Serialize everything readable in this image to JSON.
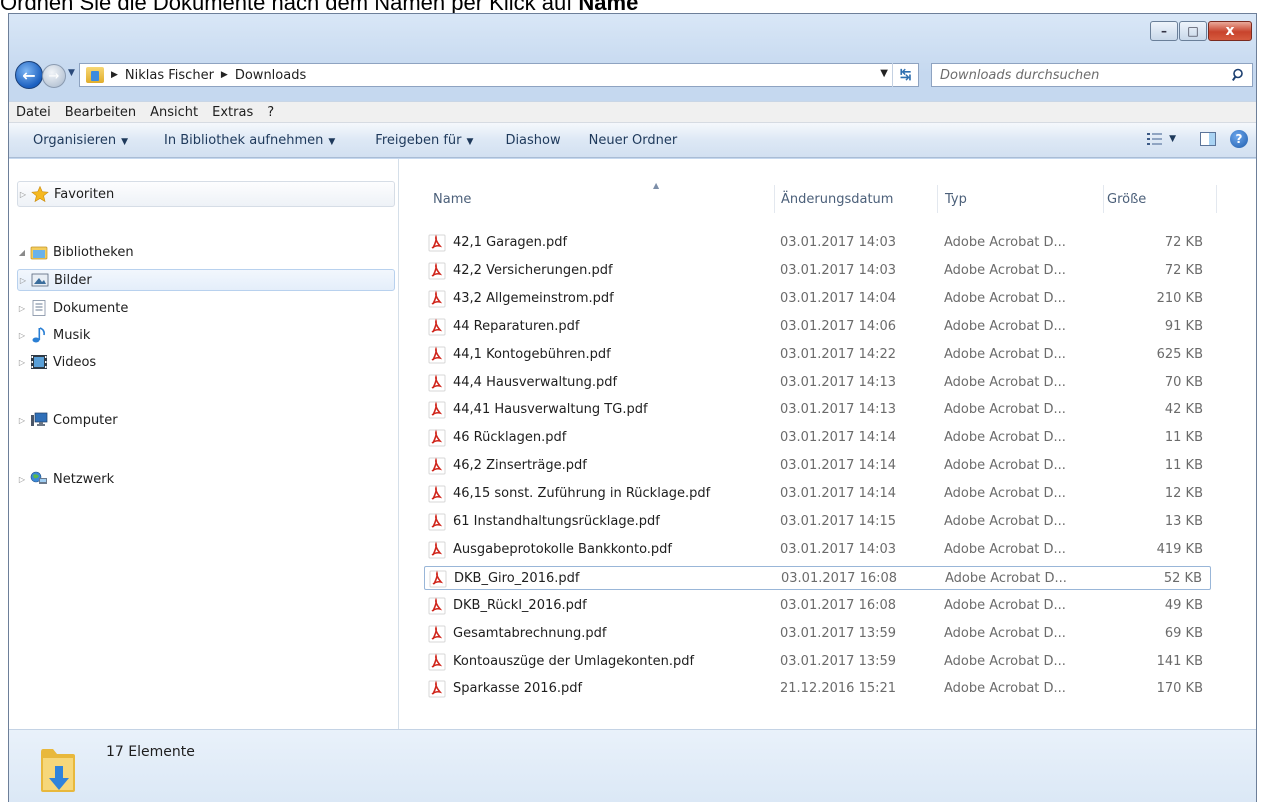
{
  "instruction": {
    "prefix": "Ordnen Sie die Dokumente nach dem Namen per Klick auf ",
    "emphasis": "Name"
  },
  "window": {
    "caption_buttons": {
      "minimize": "–",
      "maximize": "□",
      "close": "x"
    }
  },
  "address": {
    "breadcrumbs": [
      "Niklas Fischer",
      "Downloads"
    ],
    "search_placeholder": "Downloads durchsuchen"
  },
  "menubar": [
    "Datei",
    "Bearbeiten",
    "Ansicht",
    "Extras",
    "?"
  ],
  "commandbar": {
    "organize": "Organisieren",
    "include_library": "In Bibliothek aufnehmen",
    "share": "Freigeben für",
    "slideshow": "Diashow",
    "new_folder": "Neuer Ordner"
  },
  "nav": {
    "favorites": "Favoriten",
    "libraries": "Bibliotheken",
    "pictures": "Bilder",
    "documents": "Dokumente",
    "music": "Musik",
    "videos": "Videos",
    "computer": "Computer",
    "network": "Netzwerk"
  },
  "columns": {
    "name": "Name",
    "date": "Änderungsdatum",
    "type": "Typ",
    "size": "Größe"
  },
  "files": [
    {
      "name": "42,1 Garagen.pdf",
      "date": "03.01.2017 14:03",
      "type": "Adobe Acrobat D...",
      "size": "72 KB"
    },
    {
      "name": "42,2 Versicherungen.pdf",
      "date": "03.01.2017 14:03",
      "type": "Adobe Acrobat D...",
      "size": "72 KB"
    },
    {
      "name": "43,2 Allgemeinstrom.pdf",
      "date": "03.01.2017 14:04",
      "type": "Adobe Acrobat D...",
      "size": "210 KB"
    },
    {
      "name": "44 Reparaturen.pdf",
      "date": "03.01.2017 14:06",
      "type": "Adobe Acrobat D...",
      "size": "91 KB"
    },
    {
      "name": "44,1 Kontogebühren.pdf",
      "date": "03.01.2017 14:22",
      "type": "Adobe Acrobat D...",
      "size": "625 KB"
    },
    {
      "name": "44,4 Hausverwaltung.pdf",
      "date": "03.01.2017 14:13",
      "type": "Adobe Acrobat D...",
      "size": "70 KB"
    },
    {
      "name": "44,41 Hausverwaltung TG.pdf",
      "date": "03.01.2017 14:13",
      "type": "Adobe Acrobat D...",
      "size": "42 KB"
    },
    {
      "name": "46 Rücklagen.pdf",
      "date": "03.01.2017 14:14",
      "type": "Adobe Acrobat D...",
      "size": "11 KB"
    },
    {
      "name": "46,2 Zinserträge.pdf",
      "date": "03.01.2017 14:14",
      "type": "Adobe Acrobat D...",
      "size": "11 KB"
    },
    {
      "name": "46,15 sonst. Zuführung in Rücklage.pdf",
      "date": "03.01.2017 14:14",
      "type": "Adobe Acrobat D...",
      "size": "12 KB"
    },
    {
      "name": "61 Instandhaltungsrücklage.pdf",
      "date": "03.01.2017 14:15",
      "type": "Adobe Acrobat D...",
      "size": "13 KB"
    },
    {
      "name": "Ausgabeprotokolle Bankkonto.pdf",
      "date": "03.01.2017 14:03",
      "type": "Adobe Acrobat D...",
      "size": "419 KB"
    },
    {
      "name": "DKB_Giro_2016.pdf",
      "date": "03.01.2017 16:08",
      "type": "Adobe Acrobat D...",
      "size": "52 KB",
      "focused": true
    },
    {
      "name": "DKB_Rückl_2016.pdf",
      "date": "03.01.2017 16:08",
      "type": "Adobe Acrobat D...",
      "size": "49 KB"
    },
    {
      "name": "Gesamtabrechnung.pdf",
      "date": "03.01.2017 13:59",
      "type": "Adobe Acrobat D...",
      "size": "69 KB"
    },
    {
      "name": "Kontoauszüge der Umlagekonten.pdf",
      "date": "03.01.2017 13:59",
      "type": "Adobe Acrobat D...",
      "size": "141 KB"
    },
    {
      "name": "Sparkasse 2016.pdf",
      "date": "21.12.2016 15:21",
      "type": "Adobe Acrobat D...",
      "size": "170 KB"
    }
  ],
  "status": {
    "count": "17 Elemente"
  },
  "colors": {
    "accent": "#1e395b",
    "pdf_red": "#d0271d",
    "selection": "#e4eefa"
  }
}
